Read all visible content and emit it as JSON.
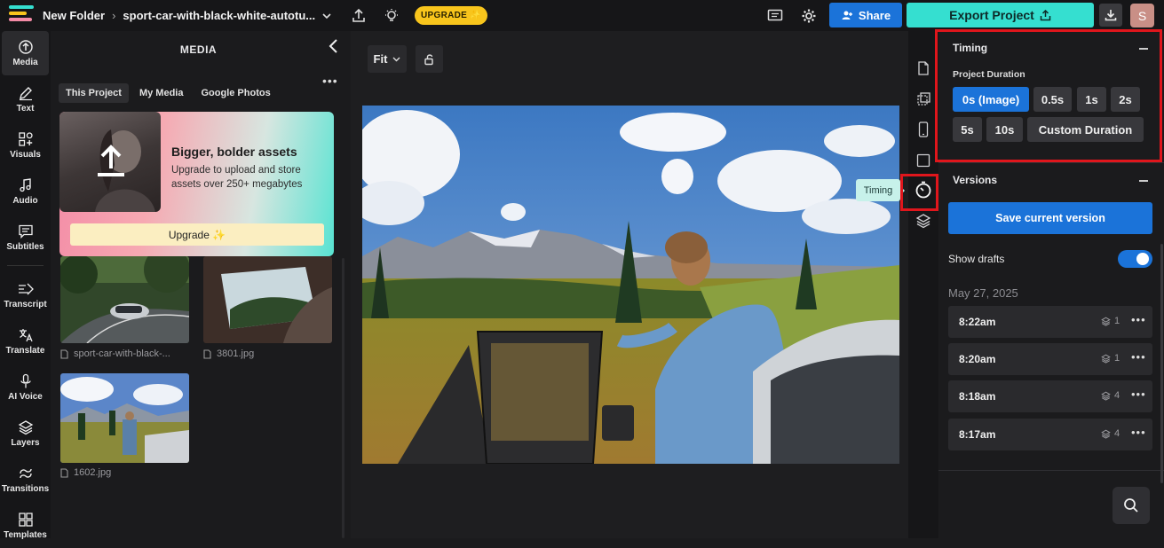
{
  "topbar": {
    "folder": "New Folder",
    "project_name": "sport-car-with-black-white-autotu...",
    "upgrade_label": "UPGRADE ✨",
    "share_label": "Share",
    "export_label": "Export Project",
    "avatar_initial": "S",
    "icons": [
      "upload-icon",
      "bulb-icon",
      "comment-icon",
      "gear-icon",
      "download-icon"
    ],
    "colors": {
      "share": "#1b73d9",
      "export": "#35dfd0",
      "upgrade": "#f8c51c"
    }
  },
  "nav": {
    "items": [
      {
        "label": "Media",
        "icon": "upload-cloud-icon"
      },
      {
        "label": "Text",
        "icon": "pen-icon"
      },
      {
        "label": "Visuals",
        "icon": "shapes-icon"
      },
      {
        "label": "Audio",
        "icon": "music-note-icon"
      },
      {
        "label": "Subtitles",
        "icon": "subtitles-icon"
      },
      {
        "label": "Transcript",
        "icon": "transcript-icon"
      },
      {
        "label": "Translate",
        "icon": "translate-icon"
      },
      {
        "label": "AI Voice",
        "icon": "ai-voice-icon"
      },
      {
        "label": "Layers",
        "icon": "layers-icon"
      },
      {
        "label": "Transitions",
        "icon": "transitions-icon"
      },
      {
        "label": "Templates",
        "icon": "templates-icon"
      }
    ]
  },
  "media": {
    "title": "MEDIA",
    "tabs": [
      "This Project",
      "My Media",
      "Google Photos"
    ],
    "promo": {
      "heading": "Bigger, bolder assets",
      "body": "Upgrade to upload and store assets over 250+ megabytes",
      "button": "Upgrade ✨"
    },
    "files": [
      {
        "name": "sport-car-with-black-...",
        "icon": "file-icon"
      },
      {
        "name": "3801.jpg",
        "icon": "file-icon"
      },
      {
        "name": "1602.jpg",
        "icon": "file-icon"
      }
    ]
  },
  "canvas": {
    "fit_label": "Fit"
  },
  "tooltip": {
    "timing": "Timing"
  },
  "panel": {
    "timing": {
      "title": "Timing",
      "project_duration_label": "Project Duration",
      "options": [
        "0s (Image)",
        "0.5s",
        "1s",
        "2s",
        "5s",
        "10s",
        "Custom Duration"
      ],
      "selected": "0s (Image)"
    },
    "versions": {
      "title": "Versions",
      "save_label": "Save current version",
      "show_drafts_label": "Show drafts",
      "show_drafts_on": true,
      "date": "May 27, 2025",
      "rows": [
        {
          "time": "8:22am",
          "count": "1"
        },
        {
          "time": "8:20am",
          "count": "1"
        },
        {
          "time": "8:18am",
          "count": "4"
        },
        {
          "time": "8:17am",
          "count": "4"
        }
      ]
    }
  }
}
